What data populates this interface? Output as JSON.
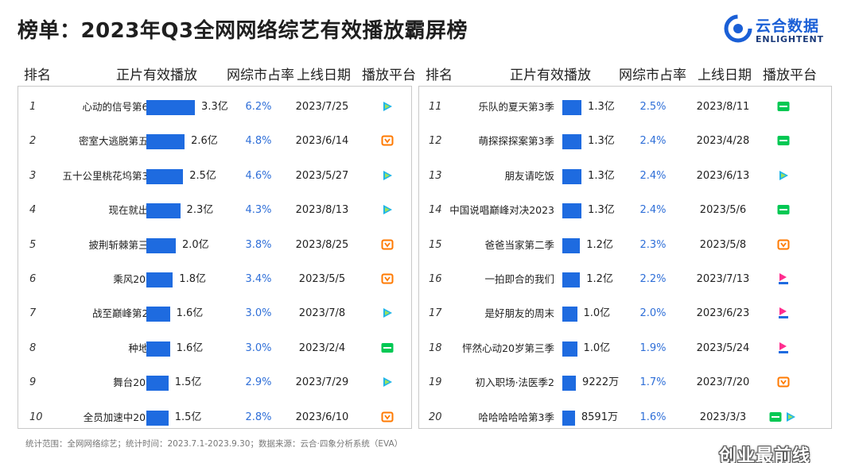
{
  "title": "榜单：2023年Q3全网网络综艺有效播放霸屏榜",
  "logo": {
    "cn": "云合数据",
    "en": "ENLIGHTENT"
  },
  "columns": {
    "rank": "排名",
    "views": "正片有效播放",
    "share": "网综市占率",
    "date": "上线日期",
    "platform": "播放平台"
  },
  "footer": "统计范围：全网网络综艺；统计时间：2023.7.1-2023.9.30；数据来源：云合·四象分析系统（EVA）",
  "watermark": "创业最前线",
  "colors": {
    "bar": "#1e6be0",
    "share_text": "#2f6fd8",
    "tencent": "#1fb5e8",
    "mango": "#ff7a00",
    "iqiyi": "#00c853",
    "youku": "#ff2d8e"
  },
  "chart_data": {
    "type": "table",
    "unit_note": "正片有效播放（亿 / 万）",
    "rows": [
      {
        "rank": "1",
        "name": "心动的信号第6季",
        "views": 3.3,
        "views_label": "3.3亿",
        "share": "6.2%",
        "date": "2023/7/25",
        "platforms": [
          "tencent-video"
        ]
      },
      {
        "rank": "2",
        "name": "密室大逃脱第五季",
        "views": 2.6,
        "views_label": "2.6亿",
        "share": "4.8%",
        "date": "2023/6/14",
        "platforms": [
          "mango-tv"
        ]
      },
      {
        "rank": "3",
        "name": "五十公里桃花坞第3季",
        "views": 2.5,
        "views_label": "2.5亿",
        "share": "4.6%",
        "date": "2023/5/27",
        "platforms": [
          "tencent-video"
        ]
      },
      {
        "rank": "4",
        "name": "现在就出发",
        "views": 2.3,
        "views_label": "2.3亿",
        "share": "4.3%",
        "date": "2023/8/13",
        "platforms": [
          "tencent-video"
        ]
      },
      {
        "rank": "5",
        "name": "披荆斩棘第三季",
        "views": 2.0,
        "views_label": "2.0亿",
        "share": "3.8%",
        "date": "2023/8/25",
        "platforms": [
          "mango-tv"
        ]
      },
      {
        "rank": "6",
        "name": "乘风2023",
        "views": 1.8,
        "views_label": "1.8亿",
        "share": "3.4%",
        "date": "2023/5/5",
        "platforms": [
          "mango-tv"
        ]
      },
      {
        "rank": "7",
        "name": "战至巅峰第2季",
        "views": 1.6,
        "views_label": "1.6亿",
        "share": "3.0%",
        "date": "2023/7/8",
        "platforms": [
          "tencent-video"
        ]
      },
      {
        "rank": "8",
        "name": "种地吧",
        "views": 1.6,
        "views_label": "1.6亿",
        "share": "3.0%",
        "date": "2023/2/4",
        "platforms": [
          "iqiyi"
        ]
      },
      {
        "rank": "9",
        "name": "舞台2023",
        "views": 1.5,
        "views_label": "1.5亿",
        "share": "2.9%",
        "date": "2023/7/29",
        "platforms": [
          "tencent-video"
        ]
      },
      {
        "rank": "10",
        "name": "全员加速中2023",
        "views": 1.5,
        "views_label": "1.5亿",
        "share": "2.8%",
        "date": "2023/6/10",
        "platforms": [
          "mango-tv"
        ]
      },
      {
        "rank": "11",
        "name": "乐队的夏天第3季",
        "views": 1.3,
        "views_label": "1.3亿",
        "share": "2.5%",
        "date": "2023/8/11",
        "platforms": [
          "iqiyi"
        ]
      },
      {
        "rank": "12",
        "name": "萌探探探案第3季",
        "views": 1.3,
        "views_label": "1.3亿",
        "share": "2.4%",
        "date": "2023/4/28",
        "platforms": [
          "iqiyi"
        ]
      },
      {
        "rank": "13",
        "name": "朋友请吃饭",
        "views": 1.3,
        "views_label": "1.3亿",
        "share": "2.4%",
        "date": "2023/6/13",
        "platforms": [
          "tencent-video"
        ]
      },
      {
        "rank": "14",
        "name": "中国说唱巅峰对决2023",
        "views": 1.3,
        "views_label": "1.3亿",
        "share": "2.4%",
        "date": "2023/5/6",
        "platforms": [
          "iqiyi"
        ]
      },
      {
        "rank": "15",
        "name": "爸爸当家第二季",
        "views": 1.2,
        "views_label": "1.2亿",
        "share": "2.3%",
        "date": "2023/5/8",
        "platforms": [
          "mango-tv"
        ]
      },
      {
        "rank": "16",
        "name": "一拍即合的我们",
        "views": 1.2,
        "views_label": "1.2亿",
        "share": "2.2%",
        "date": "2023/7/13",
        "platforms": [
          "youku"
        ]
      },
      {
        "rank": "17",
        "name": "是好朋友的周末",
        "views": 1.0,
        "views_label": "1.0亿",
        "share": "2.0%",
        "date": "2023/6/23",
        "platforms": [
          "youku"
        ]
      },
      {
        "rank": "18",
        "name": "怦然心动20岁第三季",
        "views": 1.0,
        "views_label": "1.0亿",
        "share": "1.9%",
        "date": "2023/5/24",
        "platforms": [
          "youku"
        ]
      },
      {
        "rank": "19",
        "name": "初入职场·法医季2",
        "views": 0.9222,
        "views_label": "9222万",
        "share": "1.7%",
        "date": "2023/7/20",
        "platforms": [
          "mango-tv"
        ]
      },
      {
        "rank": "20",
        "name": "哈哈哈哈哈第3季",
        "views": 0.8591,
        "views_label": "8591万",
        "share": "1.6%",
        "date": "2023/3/3",
        "platforms": [
          "iqiyi",
          "tencent-video"
        ]
      }
    ]
  }
}
